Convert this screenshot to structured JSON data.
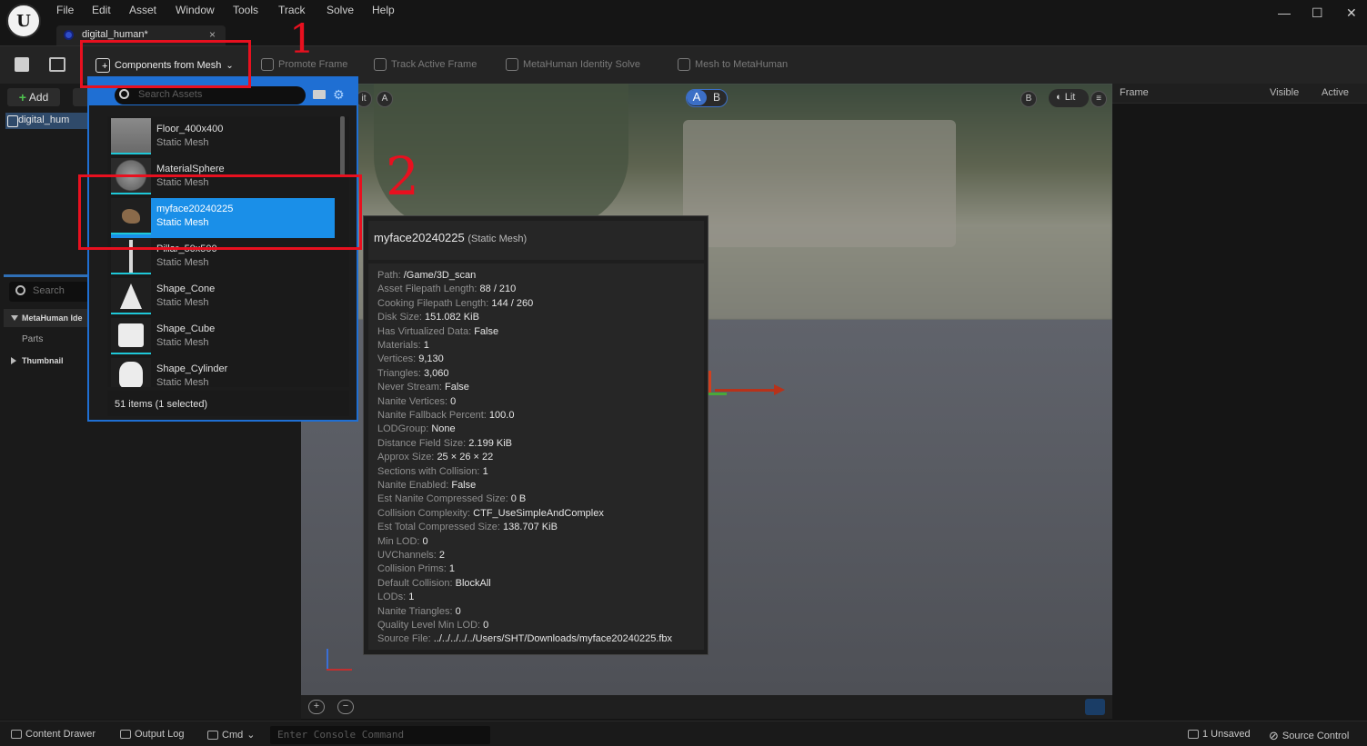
{
  "menu": {
    "items": [
      "File",
      "Edit",
      "Asset",
      "Window",
      "Tools",
      "Track",
      "Solve",
      "Help"
    ]
  },
  "window_controls": {
    "minimize": "—",
    "maximize": "☐",
    "close": "✕"
  },
  "tab": {
    "label": "digital_human*",
    "close": "×"
  },
  "toolbar": {
    "components_from_mesh": "Components from Mesh",
    "promote_frame": "Promote Frame",
    "track_active_frame": "Track Active Frame",
    "identity_solve": "MetaHuman Identity Solve",
    "mesh_to_metahuman": "Mesh to MetaHuman"
  },
  "left_panel": {
    "add_label": "Add",
    "tree_item": "digital_hum",
    "search_placeholder": "Search",
    "category_metahuman": "MetaHuman Ide",
    "category_parts": "Parts",
    "category_thumbnail": "Thumbnail"
  },
  "asset_picker": {
    "search_placeholder": "Search Assets",
    "items": [
      {
        "name": "Floor_400x400",
        "type": "Static Mesh"
      },
      {
        "name": "MaterialSphere",
        "type": "Static Mesh"
      },
      {
        "name": "myface20240225",
        "type": "Static Mesh"
      },
      {
        "name": "Pillar_50x500",
        "type": "Static Mesh"
      },
      {
        "name": "Shape_Cone",
        "type": "Static Mesh"
      },
      {
        "name": "Shape_Cube",
        "type": "Static Mesh"
      },
      {
        "name": "Shape_Cylinder",
        "type": "Static Mesh"
      }
    ],
    "selected_index": 2,
    "footer": "51 items (1 selected)"
  },
  "tooltip": {
    "title": "myface20240225",
    "title_type": "(Static Mesh)",
    "rows": [
      {
        "key": "Path:",
        "value": "/Game/3D_scan"
      },
      {
        "key": "Asset Filepath Length:",
        "value": "88 / 210"
      },
      {
        "key": "Cooking Filepath Length:",
        "value": "144 / 260"
      },
      {
        "key": "Disk Size:",
        "value": "151.082 KiB"
      },
      {
        "key": "Has Virtualized Data:",
        "value": "False"
      },
      {
        "key": "Materials:",
        "value": "1"
      },
      {
        "key": "Vertices:",
        "value": "9,130"
      },
      {
        "key": "Triangles:",
        "value": "3,060"
      },
      {
        "key": "Never Stream:",
        "value": "False"
      },
      {
        "key": "Nanite Vertices:",
        "value": "0"
      },
      {
        "key": "Nanite Fallback Percent:",
        "value": "100.0"
      },
      {
        "key": "LODGroup:",
        "value": "None"
      },
      {
        "key": "Distance Field Size:",
        "value": "2.199 KiB"
      },
      {
        "key": "Approx Size:",
        "value": "25 × 26 × 22"
      },
      {
        "key": "Sections with Collision:",
        "value": "1"
      },
      {
        "key": "Nanite Enabled:",
        "value": "False"
      },
      {
        "key": "Est Nanite Compressed Size:",
        "value": "0 B"
      },
      {
        "key": "Collision Complexity:",
        "value": "CTF_UseSimpleAndComplex"
      },
      {
        "key": "Est Total Compressed Size:",
        "value": "138.707 KiB"
      },
      {
        "key": "Min LOD:",
        "value": "0"
      },
      {
        "key": "UVChannels:",
        "value": "2"
      },
      {
        "key": "Collision Prims:",
        "value": "1"
      },
      {
        "key": "Default Collision:",
        "value": "BlockAll"
      },
      {
        "key": "LODs:",
        "value": "1"
      },
      {
        "key": "Nanite Triangles:",
        "value": "0"
      },
      {
        "key": "Quality Level Min LOD:",
        "value": "0"
      },
      {
        "key": "Source File:",
        "value": "../../../../../Users/SHT/Downloads/myface20240225.fbx"
      }
    ]
  },
  "viewport": {
    "ab_a": "A",
    "ab_b": "B",
    "left_a": "A",
    "left_it": "it",
    "right_b": "B",
    "lit": "Lit",
    "zoom_in": "+",
    "zoom_out": "−"
  },
  "right_panel": {
    "col_frame": "Frame",
    "col_visible": "Visible",
    "col_active": "Active"
  },
  "annotations": {
    "one": "1",
    "two": "2"
  },
  "statusbar": {
    "content_drawer": "Content Drawer",
    "output_log": "Output Log",
    "cmd": "Cmd",
    "console_placeholder": "Enter Console Command",
    "unsaved": "1 Unsaved",
    "source_control": "Source Control"
  },
  "colors": {
    "accent_blue": "#1f6fd3",
    "selection_blue": "#1a8fe8",
    "annotation_red": "#e8101f"
  }
}
